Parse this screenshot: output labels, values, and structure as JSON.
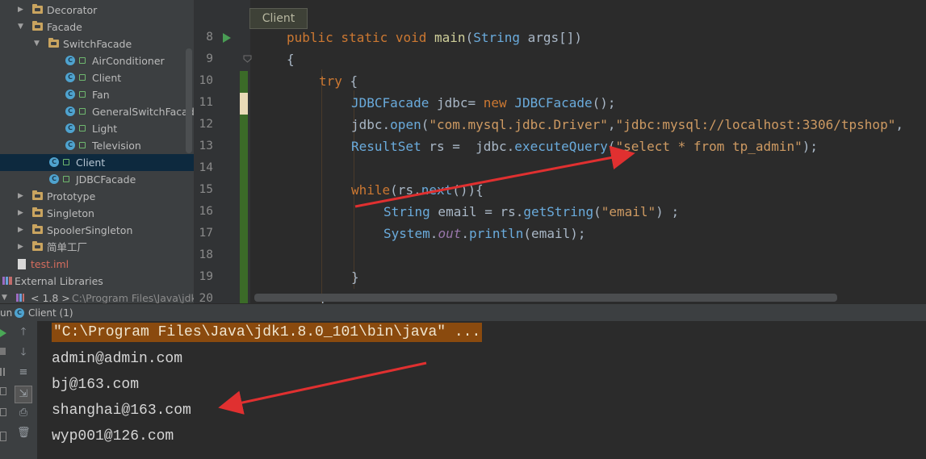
{
  "tree": {
    "items": [
      {
        "label": "Decorator",
        "icon": "folder-icon"
      },
      {
        "label": "Facade",
        "icon": "folder-icon"
      },
      {
        "label": "SwitchFacade",
        "icon": "folder-icon"
      },
      {
        "label": "AirConditioner",
        "icon": "class-icon"
      },
      {
        "label": "Client",
        "icon": "class-icon"
      },
      {
        "label": "Fan",
        "icon": "class-icon"
      },
      {
        "label": "GeneralSwitchFacade",
        "icon": "class-icon"
      },
      {
        "label": "Light",
        "icon": "class-icon"
      },
      {
        "label": "Television",
        "icon": "class-icon"
      },
      {
        "label": "Client",
        "icon": "class-icon",
        "selected": true
      },
      {
        "label": "JDBCFacade",
        "icon": "class-icon"
      },
      {
        "label": "Prototype",
        "icon": "folder-icon"
      },
      {
        "label": "Singleton",
        "icon": "folder-icon"
      },
      {
        "label": "SpoolerSingleton",
        "icon": "folder-icon"
      },
      {
        "label": "简单工厂",
        "icon": "folder-icon"
      },
      {
        "label": "test.iml",
        "icon": "file-icon"
      },
      {
        "label": "External Libraries",
        "icon": "libraries-icon"
      },
      {
        "label": "< 1.8 >",
        "icon": "jdk-icon"
      },
      {
        "label": "C:\\Program Files\\Java\\jdk",
        "icon": ""
      }
    ]
  },
  "editor": {
    "tooltip": "Client",
    "line_numbers": [
      "8",
      "9",
      "10",
      "11",
      "12",
      "13",
      "14",
      "15",
      "16",
      "17",
      "18",
      "19",
      "20"
    ]
  },
  "code": {
    "l8": {
      "a": "public static void ",
      "b": "main",
      "c": "(",
      "d": "String",
      "e": " args[])"
    },
    "l9": "{",
    "l10": {
      "a": "try",
      "b": " {"
    },
    "l11": {
      "a": "JDBCFacade",
      "b": " jdbc= ",
      "c": "new",
      "d": " ",
      "e": "JDBCFacade",
      "f": "();"
    },
    "l12": {
      "a": "jdbc.",
      "b": "open",
      "c": "(",
      "d": "\"com.mysql.jdbc.Driver\"",
      "e": ",",
      "f": "\"jdbc:mysql://localhost:3306/tpshop\"",
      "g": ","
    },
    "l13": {
      "a": "ResultSet",
      "b": " rs =  jdbc.",
      "c": "executeQuery",
      "d": "(",
      "e": "\"select * from tp_admin\"",
      "f": ");"
    },
    "l15": {
      "a": "while",
      "b": "(rs.",
      "c": "next",
      "d": "()){"
    },
    "l16": {
      "a": "String",
      "b": " email = rs.",
      "c": "getString",
      "d": "(",
      "e": "\"email\"",
      "f": ") ;"
    },
    "l17": {
      "a": "System",
      "b": ".",
      "c": "out",
      "d": ".",
      "e": "println",
      "f": "(email);"
    },
    "l19": "}",
    "l20": "}"
  },
  "run_bar": {
    "prefix": "un",
    "title": "Client (1)"
  },
  "console": {
    "command": "\"C:\\Program Files\\Java\\jdk1.8.0_101\\bin\\java\" ...",
    "output": [
      "admin@admin.com",
      "bj@163.com",
      "shanghai@163.com",
      "wyp001@126.com"
    ]
  },
  "colors": {
    "keyword": "#cc7832",
    "string": "#ce9a62",
    "annotation_arrow": "#e03030",
    "selection": "#0d293e"
  }
}
